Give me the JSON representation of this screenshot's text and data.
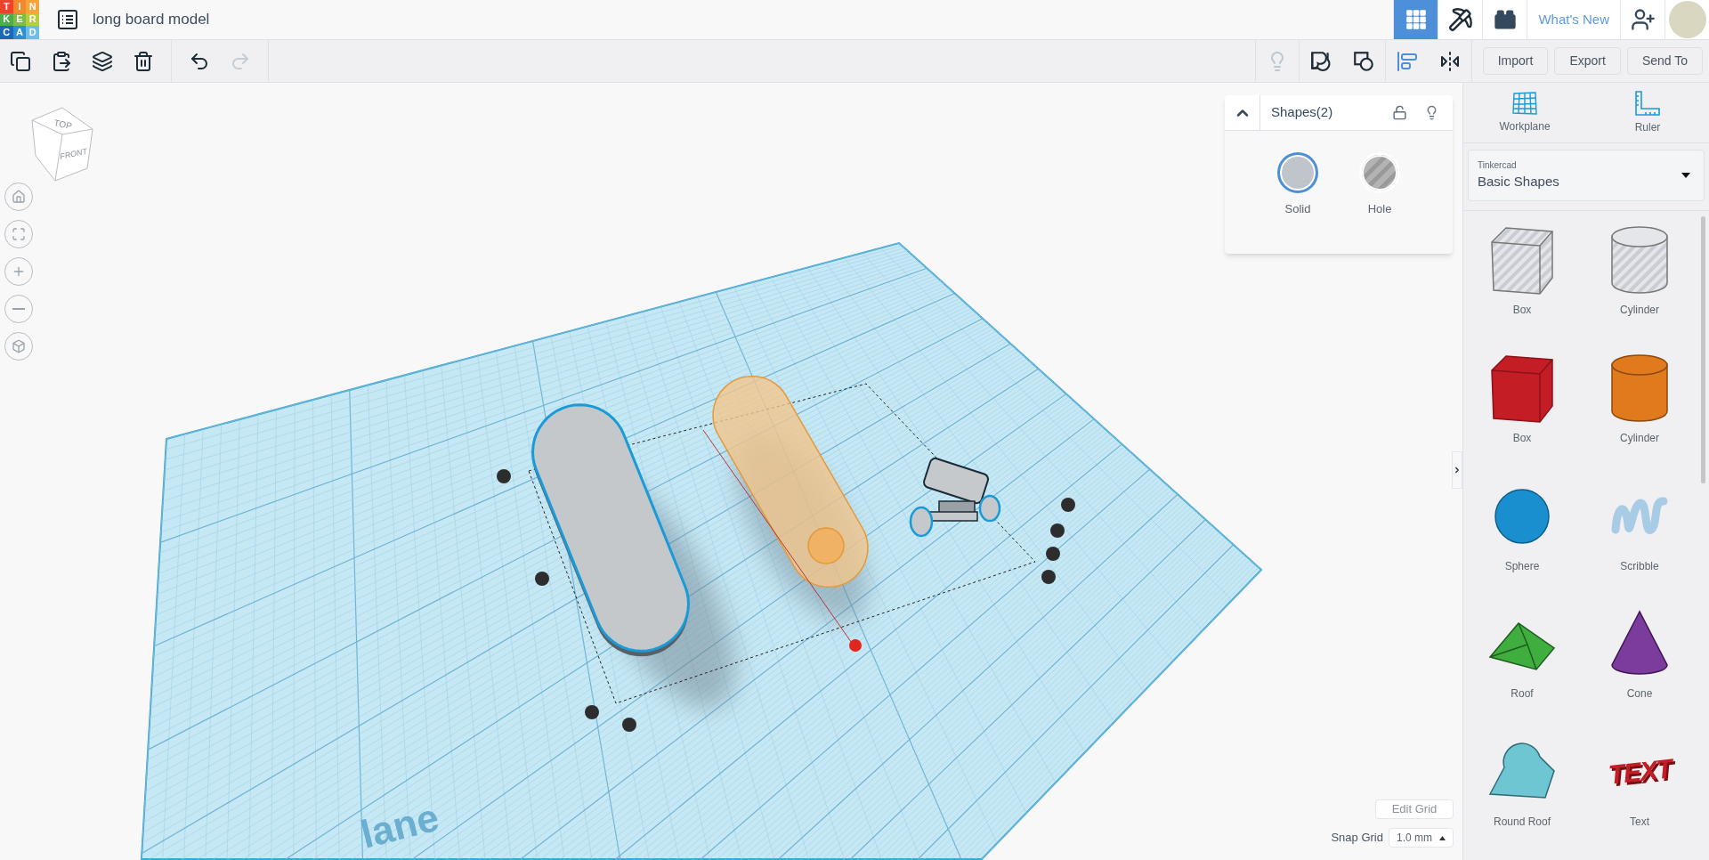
{
  "app": {
    "title": "long board model",
    "logo": [
      {
        "letter": "T",
        "color": "#e8452c"
      },
      {
        "letter": "I",
        "color": "#f4882a"
      },
      {
        "letter": "N",
        "color": "#f9a33b"
      },
      {
        "letter": "K",
        "color": "#4aae49"
      },
      {
        "letter": "E",
        "color": "#7dbd42"
      },
      {
        "letter": "R",
        "color": "#b6cd3c"
      },
      {
        "letter": "C",
        "color": "#1c68b4"
      },
      {
        "letter": "A",
        "color": "#2f8fd0"
      },
      {
        "letter": "D",
        "color": "#6fbce6"
      }
    ]
  },
  "nav": [
    {
      "kind": "grid",
      "selected": true
    },
    {
      "kind": "pickaxe",
      "selected": false
    },
    {
      "kind": "bricks",
      "selected": false
    },
    {
      "kind": "link",
      "label": "What's New",
      "selected": false
    },
    {
      "kind": "add-user",
      "selected": false
    },
    {
      "kind": "avatar",
      "selected": false
    }
  ],
  "toolbar_left": [
    {
      "kind": "copy",
      "disabled": false
    },
    {
      "kind": "paste",
      "disabled": false
    },
    {
      "kind": "duplicate",
      "disabled": false
    },
    {
      "kind": "delete",
      "disabled": false
    },
    {
      "kind": "undo",
      "disabled": false
    },
    {
      "kind": "redo",
      "disabled": true
    }
  ],
  "toolbar_right": [
    {
      "kind": "light",
      "disabled": true
    },
    {
      "kind": "group",
      "disabled": false
    },
    {
      "kind": "ungroup",
      "disabled": false
    },
    {
      "kind": "align",
      "disabled": false
    },
    {
      "kind": "mirror",
      "disabled": false
    }
  ],
  "actions": [
    "Import",
    "Export",
    "Send To"
  ],
  "view_cube": {
    "top": "TOP",
    "front": "FRONT"
  },
  "view_controls": [
    {
      "kind": "home"
    },
    {
      "kind": "fit"
    },
    {
      "kind": "zoom-in"
    },
    {
      "kind": "zoom-out"
    },
    {
      "kind": "ortho"
    }
  ],
  "inspector": {
    "title": "Shapes(2)",
    "expanded": true,
    "locked": false,
    "options": [
      {
        "kind": "solid",
        "label": "Solid",
        "selected": true
      },
      {
        "kind": "hole",
        "label": "Hole",
        "selected": false
      }
    ]
  },
  "workplane": {
    "label": "lane"
  },
  "grid_controls": {
    "edit": "Edit Grid",
    "snap_label": "Snap Grid",
    "snap_value": "1.0 mm"
  },
  "tools": [
    {
      "kind": "workplane",
      "label": "Workplane"
    },
    {
      "kind": "ruler",
      "label": "Ruler"
    }
  ],
  "library": {
    "provider": "Tinkercad",
    "name": "Basic Shapes"
  },
  "shapes": [
    {
      "kind": "box-hole",
      "label": "Box",
      "color": "#c9ccd3"
    },
    {
      "kind": "cylinder-hole",
      "label": "Cylinder",
      "color": "#c9ccd3"
    },
    {
      "kind": "box",
      "label": "Box",
      "color": "#c41d26"
    },
    {
      "kind": "cylinder",
      "label": "Cylinder",
      "color": "#e07a1d"
    },
    {
      "kind": "sphere",
      "label": "Sphere",
      "color": "#1a8fcf"
    },
    {
      "kind": "scribble",
      "label": "Scribble",
      "color": "#a8cbe6"
    },
    {
      "kind": "roof",
      "label": "Roof",
      "color": "#3fae3f"
    },
    {
      "kind": "cone",
      "label": "Cone",
      "color": "#7b3c9e"
    },
    {
      "kind": "round-roof",
      "label": "Round Roof",
      "color": "#6fc6d3"
    },
    {
      "kind": "text",
      "label": "Text",
      "color": "#c41d26",
      "art": "TEXT"
    }
  ]
}
